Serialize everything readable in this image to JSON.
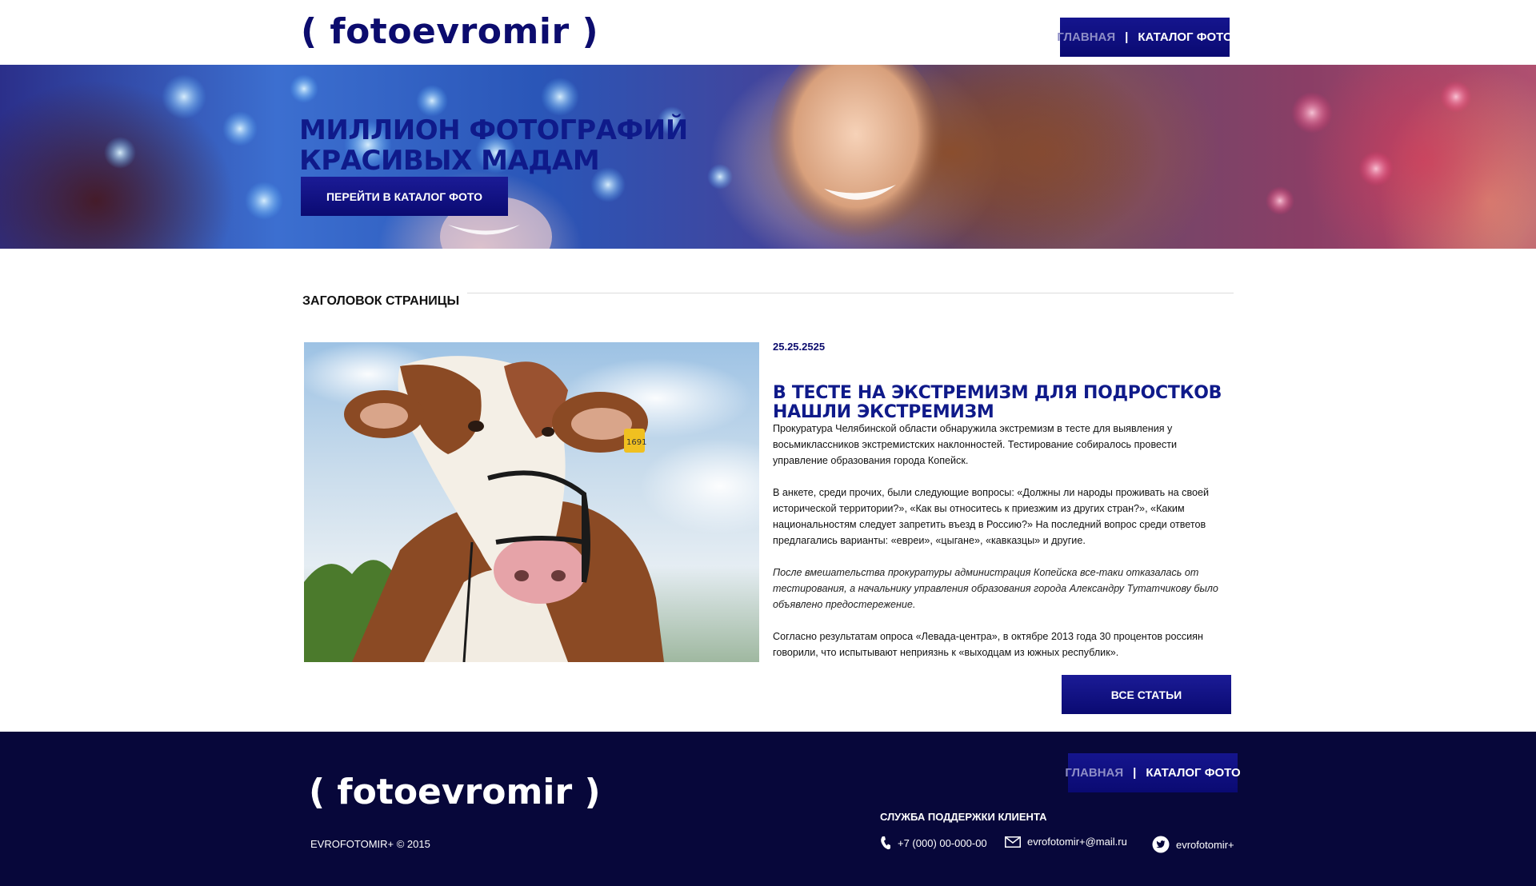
{
  "header": {
    "logo": "( fotoevromir )",
    "nav": {
      "home": "ГЛАВНАЯ",
      "separator": "|",
      "catalog": "КАТАЛОГ ФОТО"
    }
  },
  "hero": {
    "title_line1": "МИЛЛИОН ФОТОГРАФИЙ",
    "title_line2": "КРАСИВЫХ МАДАМ",
    "button": "ПЕРЕЙТИ В КАТАЛОГ ФОТО"
  },
  "main": {
    "section_title": "ЗАГОЛОВОК СТРАНИЦЫ",
    "article": {
      "date": "25.25.2525",
      "title_line1": "В ТЕСТЕ НА ЭКСТРЕМИЗМ ДЛЯ ПОДРОСТКОВ",
      "title_line2": "НАШЛИ ЭКСТРЕМИЗМ",
      "paragraphs": [
        "Прокуратура Челябинской области обнаружила экстремизм в тесте для выявления у восьмиклассников экстремистских наклонностей. Тестирование собиралось провести управление образования города Копейск.",
        "В анкете, среди прочих, были следующие вопросы: «Должны ли народы проживать на своей исторической территории?», «Как вы относитесь к приезжим из других стран?», «Каким национальностям следует запретить въезд в Россию?» На последний вопрос среди ответов предлагались варианты: «евреи», «цыгане», «кавказцы» и другие.",
        "После вмешательства прокуратуры администрация Копейска все-таки отказалась от тестирования, а начальнику управления образования города Александру Тутатчикову было объявлено предостережение.",
        "Согласно результатам опроса «Левада-центра», в октябре 2013 года 30 процентов россиян говорили, что испытывают неприязнь к «выходцам из южных республик»."
      ],
      "ear_tag": "1691"
    },
    "all_articles_button": "ВСЕ СТАТЬИ"
  },
  "footer": {
    "logo": "( fotoevromir )",
    "nav": {
      "home": "ГЛАВНАЯ",
      "separator": "|",
      "catalog": "КАТАЛОГ ФОТО"
    },
    "copyright": "EVROFOTOMIR+ © 2015",
    "support_title": "СЛУЖБА ПОДДЕРЖКИ КЛИЕНТА",
    "phone": "+7 (000) 00-000-00",
    "email": "evrofotomir+@mail.ru",
    "twitter": "evrofotomir+",
    "icons": {
      "phone": "phone-icon",
      "email": "envelope-icon",
      "twitter": "twitter-bird-icon"
    }
  },
  "colors": {
    "brand_navy": "#0c0c6e",
    "button_blue": "#12128a",
    "footer_bg": "#07073a",
    "nav_inactive": "#8d8dc6"
  }
}
